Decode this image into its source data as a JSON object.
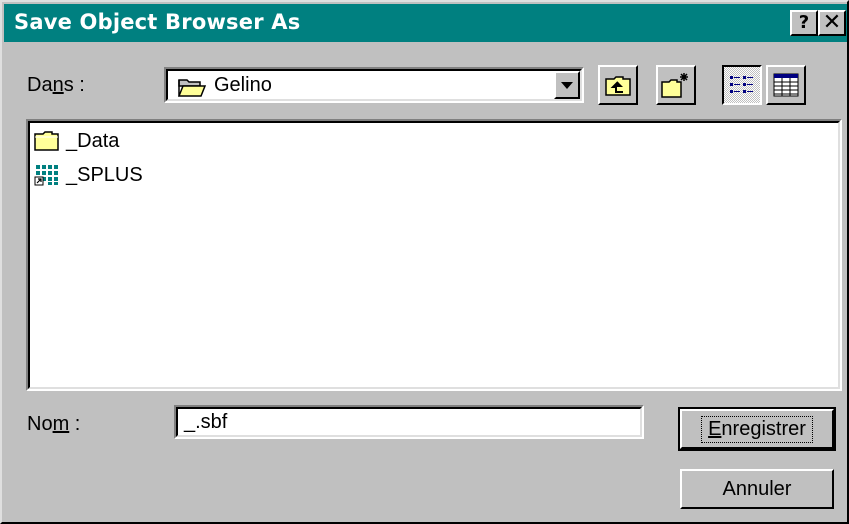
{
  "window": {
    "title": "Save Object Browser As",
    "help_glyph": "?",
    "close_glyph": "✕"
  },
  "look_in": {
    "label_pre": "Da",
    "label_mnemonic": "n",
    "label_post": "s :",
    "selected_folder": "Gelino",
    "folder_icon": "open-folder-icon"
  },
  "toolbar": {
    "up_icon": "up-one-level-icon",
    "new_folder_icon": "new-folder-icon",
    "list_icon": "list-view-icon",
    "details_icon": "details-view-icon"
  },
  "files": [
    {
      "name": "_Data",
      "icon": "folder-icon"
    },
    {
      "name": "_SPLUS",
      "icon": "splus-shortcut-icon"
    }
  ],
  "filename": {
    "label_pre": "No",
    "label_mnemonic": "m",
    "label_post": " :",
    "value": "_.sbf"
  },
  "buttons": {
    "save_mnemonic": "E",
    "save_rest": "nregistrer",
    "cancel": "Annuler"
  },
  "colors": {
    "titlebar": "#008080",
    "face": "#c0c0c0",
    "folder": "#ffff99"
  }
}
